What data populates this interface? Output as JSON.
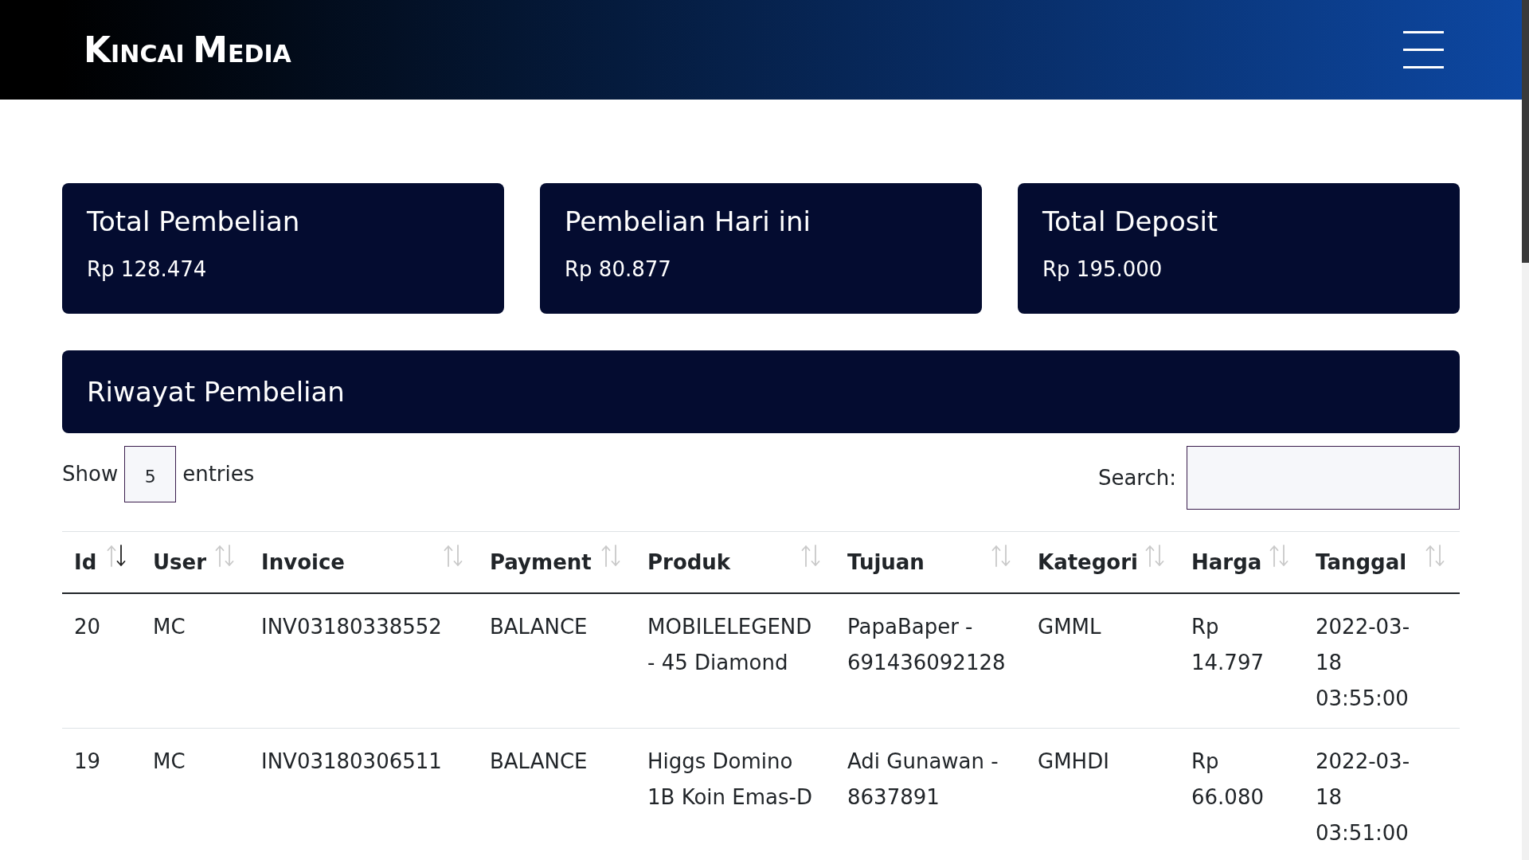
{
  "header": {
    "brand": "KINCAI MEDIA"
  },
  "stats": [
    {
      "title": "Total Pembelian",
      "value": "Rp 128.474"
    },
    {
      "title": "Pembelian Hari ini",
      "value": "Rp 80.877"
    },
    {
      "title": "Total Deposit",
      "value": "Rp 195.000"
    }
  ],
  "history": {
    "title": "Riwayat Pembelian",
    "length_menu": {
      "label_before": "Show",
      "value": "5",
      "label_after": "entries"
    },
    "search": {
      "label": "Search:"
    },
    "table": {
      "columns": [
        {
          "label": "Id",
          "sorted_desc": true
        },
        {
          "label": "User",
          "sorted_desc": false
        },
        {
          "label": "Invoice",
          "sorted_desc": false
        },
        {
          "label": "Payment",
          "sorted_desc": false
        },
        {
          "label": "Produk",
          "sorted_desc": false
        },
        {
          "label": "Tujuan",
          "sorted_desc": false
        },
        {
          "label": "Kategori",
          "sorted_desc": false
        },
        {
          "label": "Harga",
          "sorted_desc": false
        },
        {
          "label": "Tanggal",
          "sorted_desc": false
        }
      ],
      "rows": [
        [
          "20",
          "MC",
          "INV03180338552",
          "BALANCE",
          "MOBILELEGEND - 45 Diamond",
          "PapaBaper - 691436092128",
          "GMML",
          "Rp 14.797",
          "2022-03-18 03:55:00"
        ],
        [
          "19",
          "MC",
          "INV03180306511",
          "BALANCE",
          "Higgs Domino 1B Koin Emas-D",
          "Adi Gunawan - 8637891",
          "GMHDI",
          "Rp 66.080",
          "2022-03-18 03:51:00"
        ]
      ]
    }
  }
}
